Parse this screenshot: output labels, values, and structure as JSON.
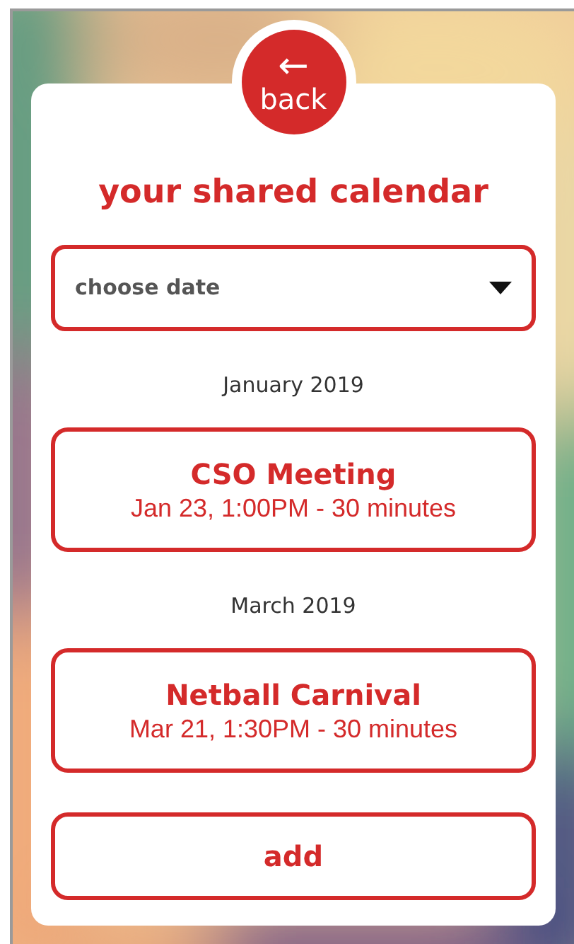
{
  "back_button": {
    "icon": "←",
    "label": "back"
  },
  "title": "your shared calendar",
  "date_select": {
    "placeholder": "choose date"
  },
  "groups": [
    {
      "month": "January 2019",
      "events": [
        {
          "name": "CSO Meeting",
          "details": "Jan 23, 1:00PM - 30 minutes"
        }
      ]
    },
    {
      "month": "March 2019",
      "events": [
        {
          "name": "Netball Carnival",
          "details": "Mar 21, 1:30PM - 30 minutes"
        }
      ]
    }
  ],
  "add_button": {
    "label": "add"
  }
}
